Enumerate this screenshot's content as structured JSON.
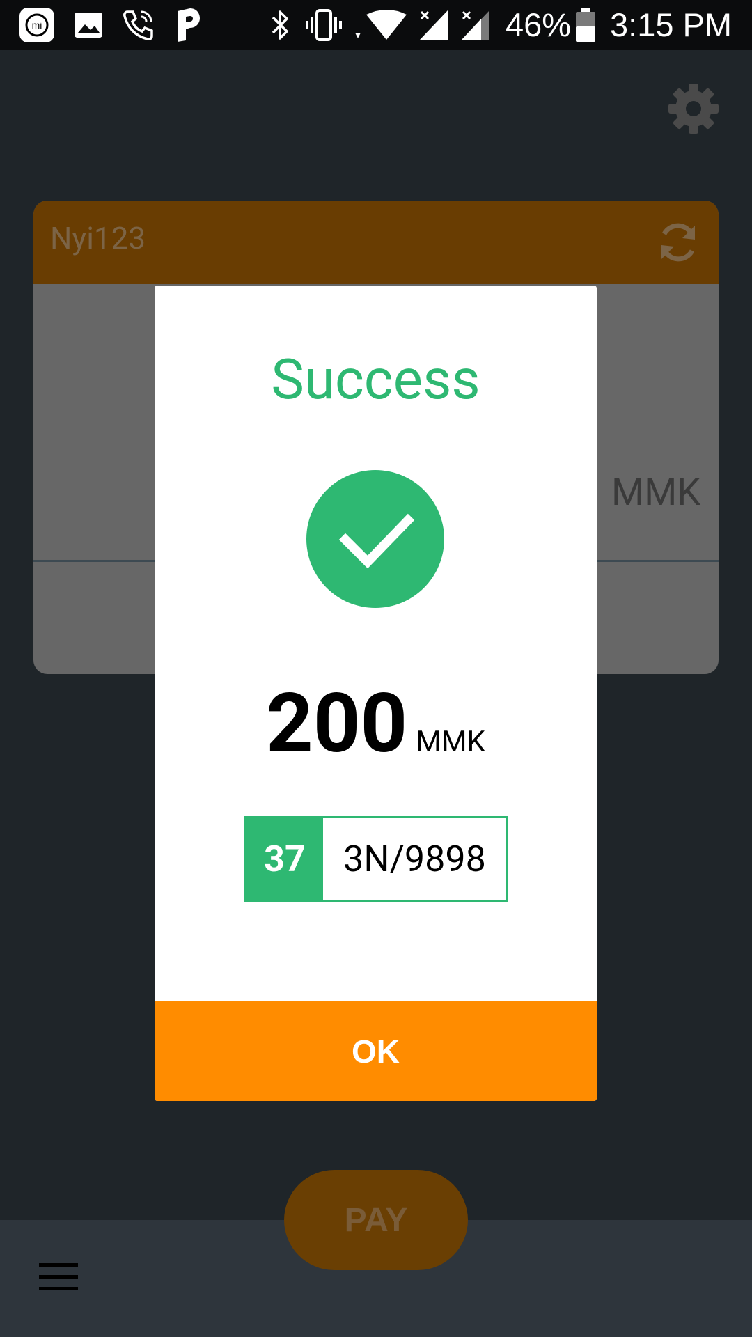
{
  "status_bar": {
    "battery": "46%",
    "time": "3:15 PM",
    "icons": [
      "mi-home-icon",
      "gallery-icon",
      "wifi-call-icon",
      "parking-app-icon",
      "bluetooth-icon",
      "vibrate-icon",
      "wifi-icon",
      "signal-icon",
      "signal-icon-2",
      "battery-icon"
    ]
  },
  "background": {
    "card_title": "Nyi123",
    "currency": "MMK",
    "pay_label": "PAY"
  },
  "dialog": {
    "title": "Success",
    "amount": "200",
    "currency": "MMK",
    "ref_number": "37",
    "ref_code": "3N/9898",
    "ok_label": "OK"
  },
  "colors": {
    "success_green": "#2eb872",
    "accent_orange": "#ff8c00",
    "dim_orange": "#693d02",
    "status_bar": "#0b0c0d"
  }
}
